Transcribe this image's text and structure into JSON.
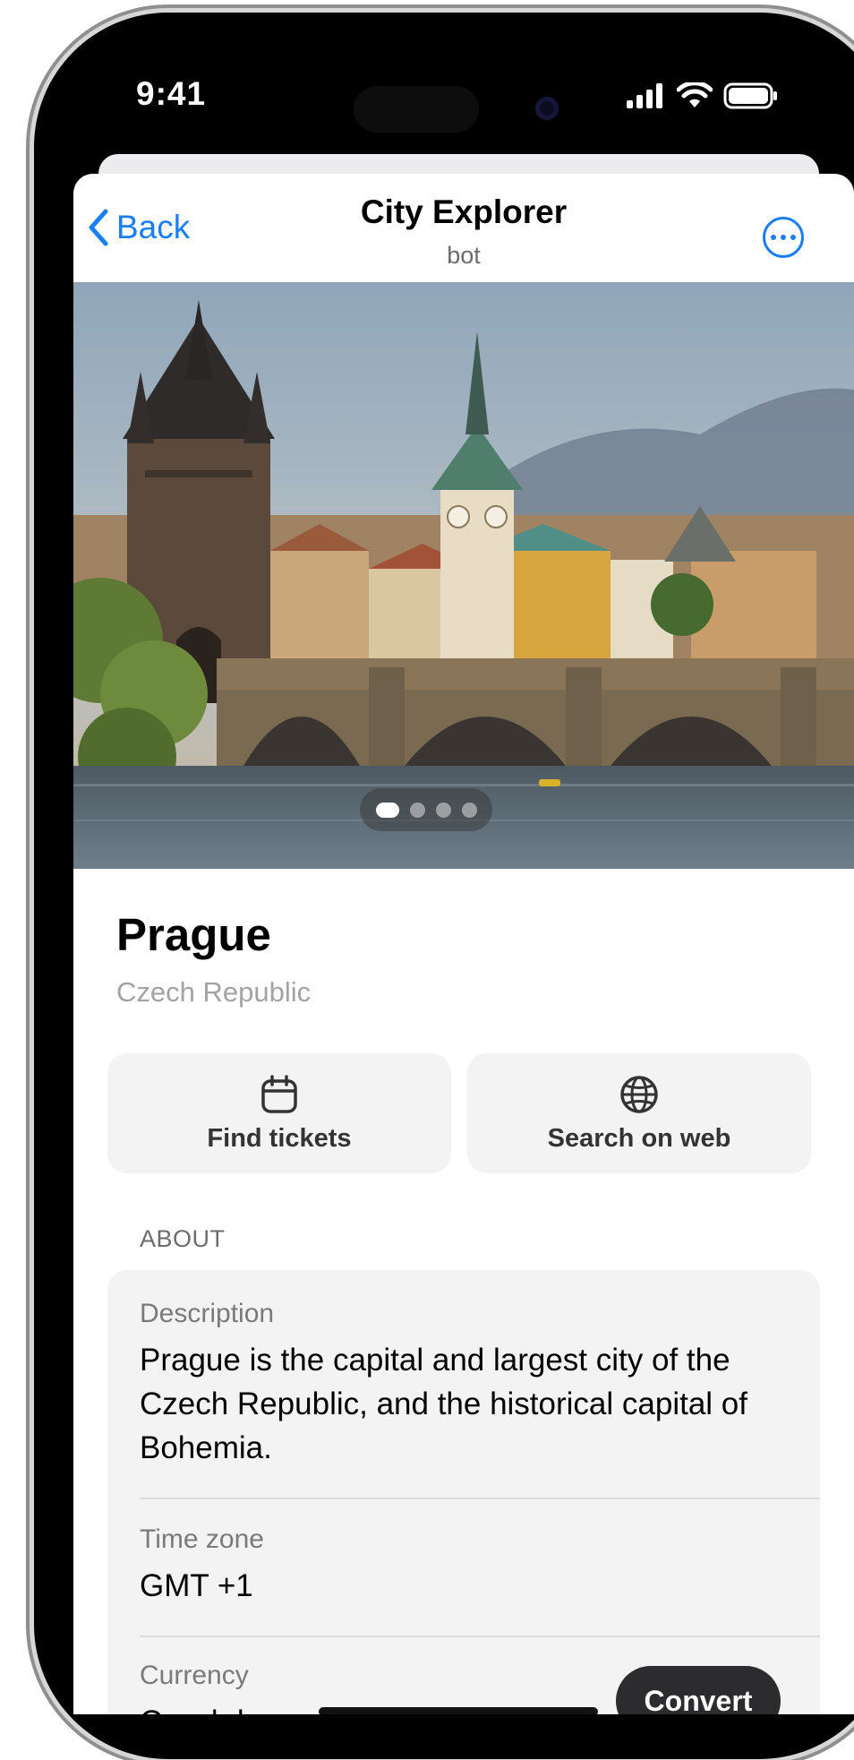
{
  "status_bar": {
    "time": "9:41",
    "icons": [
      "signal-icon",
      "wifi-icon",
      "battery-icon"
    ]
  },
  "nav": {
    "back_label": "Back",
    "title": "City Explorer",
    "subtitle": "bot",
    "more_icon": "ellipsis-circle-icon"
  },
  "hero": {
    "subject": "Prague",
    "pager": {
      "total": 4,
      "active": 1
    }
  },
  "city": {
    "name": "Prague",
    "country": "Czech Republic"
  },
  "actions": [
    {
      "label": "Find tickets",
      "icon": "calendar-icon"
    },
    {
      "label": "Search on web",
      "icon": "globe-icon"
    }
  ],
  "about": {
    "header": "ABOUT",
    "rows": [
      {
        "label": "Description",
        "value": "Prague is the capital and largest city of the Czech Republic, and the historical capital of Bohemia."
      },
      {
        "label": "Time zone",
        "value": "GMT +1"
      },
      {
        "label": "Currency",
        "value": "Czech koruna"
      }
    ]
  },
  "convert_label": "Convert",
  "colors": {
    "accent": "#1a7ef5",
    "card_bg": "#f3f3f4",
    "convert_bg": "#2c2c2e"
  }
}
